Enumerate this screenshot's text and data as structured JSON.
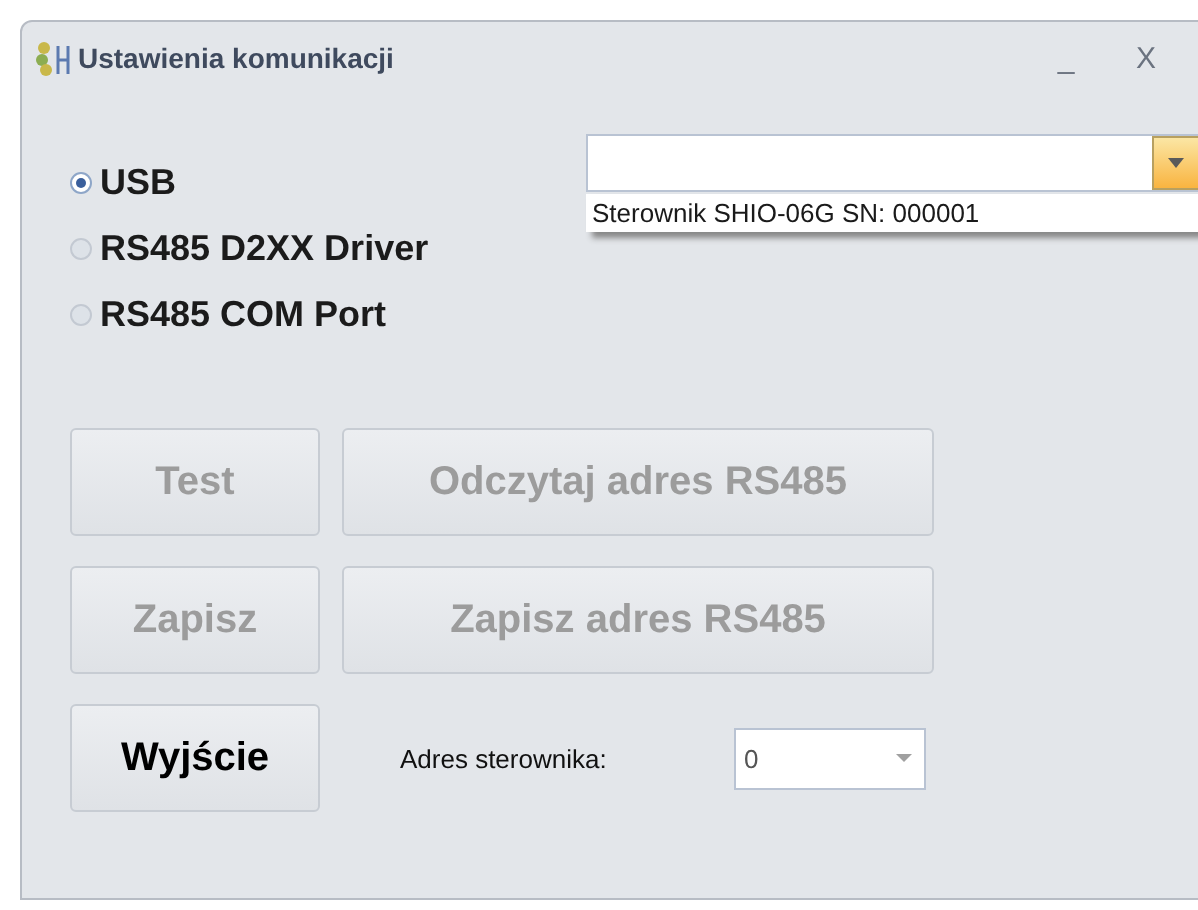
{
  "window": {
    "title": "Ustawienia komunikacji",
    "controls": [
      "_",
      "X"
    ]
  },
  "connection": [
    {
      "label": "USB",
      "selected": true
    },
    {
      "label": "RS485 D2XX Driver",
      "selected": false
    },
    {
      "label": "RS485 COM Port",
      "selected": false
    }
  ],
  "device_combo": {
    "expanded": true,
    "options": [
      "Sterownik SHIO-06G SN: 000001"
    ]
  },
  "buttons": [
    [
      {
        "label": "Test",
        "disabled": true
      },
      {
        "label": "Odczytaj adres RS485",
        "disabled": true
      }
    ],
    [
      {
        "label": "Zapisz",
        "disabled": true
      },
      {
        "label": "Zapisz adres RS485",
        "disabled": true
      }
    ],
    [
      {
        "label": "Wyjście",
        "disabled": false
      }
    ]
  ],
  "address": {
    "label": "Adres sterownika:",
    "value": "0"
  }
}
